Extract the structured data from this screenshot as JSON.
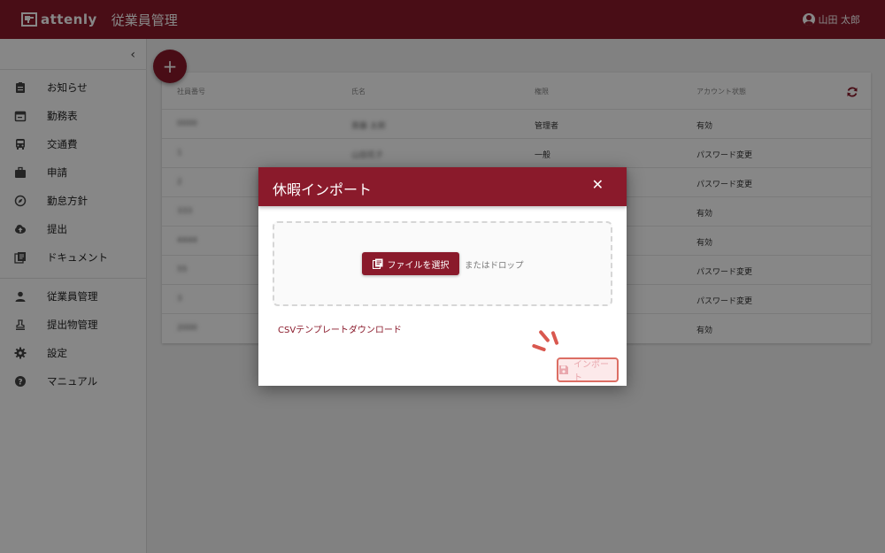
{
  "header": {
    "logo_text": "attenly",
    "title": "従業員管理",
    "user_name": "山田 太郎"
  },
  "sidebar": {
    "collapse_icon": "chevron-left-icon",
    "group1": [
      {
        "label": "お知らせ",
        "icon": "clipboard-icon"
      },
      {
        "label": "勤務表",
        "icon": "calendar-icon"
      },
      {
        "label": "交通費",
        "icon": "train-icon"
      },
      {
        "label": "申請",
        "icon": "briefcase-icon"
      },
      {
        "label": "勤怠方針",
        "icon": "compass-icon"
      },
      {
        "label": "提出",
        "icon": "cloud-upload-icon"
      },
      {
        "label": "ドキュメント",
        "icon": "library-icon"
      }
    ],
    "group2": [
      {
        "label": "従業員管理",
        "icon": "person-icon"
      },
      {
        "label": "提出物管理",
        "icon": "stamp-icon"
      },
      {
        "label": "設定",
        "icon": "gear-icon"
      },
      {
        "label": "マニュアル",
        "icon": "help-icon"
      }
    ]
  },
  "table": {
    "headers": [
      "社員番号",
      "氏名",
      "権限",
      "アカウント状態"
    ],
    "rows": [
      {
        "id": "0000",
        "name": "斎藤 太郎",
        "role": "管理者",
        "status": "有効"
      },
      {
        "id": "1",
        "name": "山田花子",
        "role": "一般",
        "status": "パスワード変更"
      },
      {
        "id": "2",
        "name": "",
        "role": "",
        "status": "パスワード変更"
      },
      {
        "id": "333",
        "name": "",
        "role": "",
        "status": "有効"
      },
      {
        "id": "4444",
        "name": "",
        "role": "",
        "status": "有効"
      },
      {
        "id": "55",
        "name": "",
        "role": "",
        "status": "パスワード変更"
      },
      {
        "id": "3",
        "name": "",
        "role": "",
        "status": "パスワード変更"
      },
      {
        "id": "2000",
        "name": "",
        "role": "",
        "status": "有効"
      }
    ]
  },
  "fab": {
    "label": "+"
  },
  "modal": {
    "title": "休暇インポート",
    "close_label": "✕",
    "pick_button": "ファイルを選択",
    "drop_text": "またはドロップ",
    "csv_link": "CSVテンプレートダウンロード",
    "import_button": "インポート"
  },
  "colors": {
    "brand": "#8a1a2b",
    "highlight": "#dc6e64"
  }
}
